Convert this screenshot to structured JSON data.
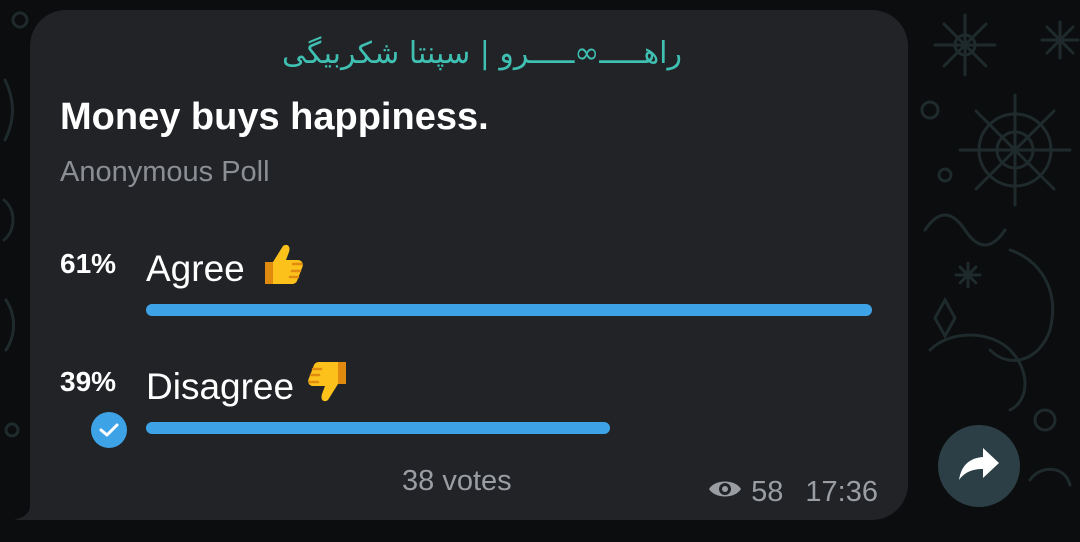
{
  "message": {
    "channel_name": "راهـــــ∞ـــــرو | سپنتا شکربیگی",
    "poll": {
      "question": "Money buys happiness.",
      "type_label": "Anonymous Poll",
      "options": [
        {
          "percent_label": "61%",
          "label": "Agree",
          "emoji": "thumbs-up",
          "fraction": 0.61,
          "chosen": false
        },
        {
          "percent_label": "39%",
          "label": "Disagree",
          "emoji": "thumbs-down",
          "fraction": 0.39,
          "chosen": true
        }
      ],
      "votes_label": "38 votes"
    },
    "views": "58",
    "time": "17:36"
  },
  "colors": {
    "accent": "#3ea3e6",
    "channel_name": "#3fc0b2",
    "bubble": "#212327",
    "background": "#0b0d0e"
  },
  "icons": {
    "views": "eye-icon",
    "share": "share-arrow-icon",
    "chosen": "checkmark-icon"
  }
}
